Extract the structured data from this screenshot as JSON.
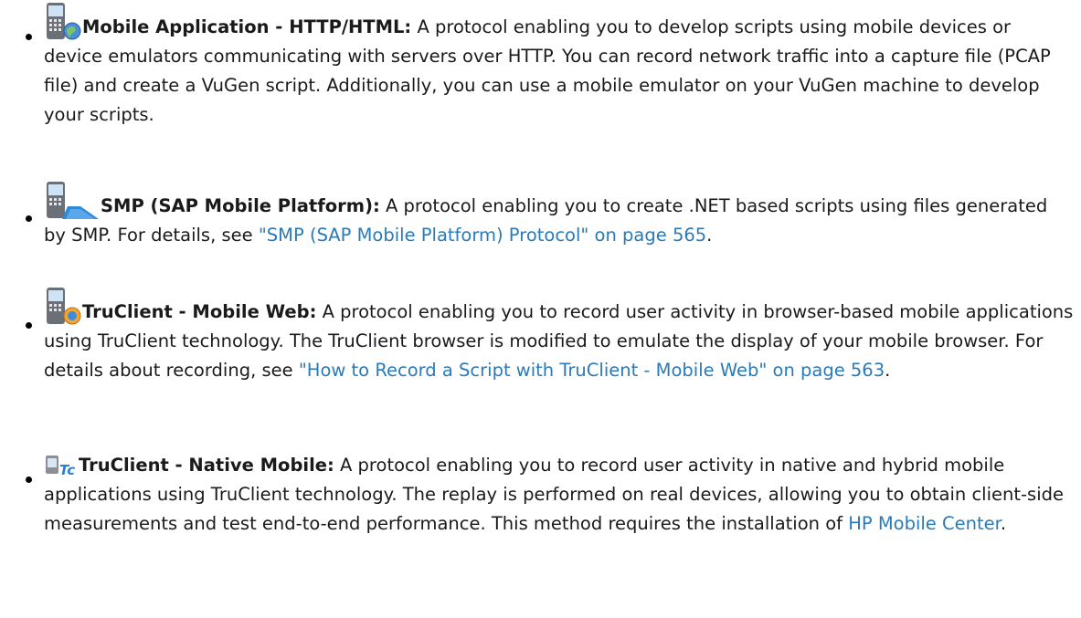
{
  "items": [
    {
      "icon": "mobile-globe-icon",
      "term": "Mobile Application - HTTP/HTML:",
      "description": "A protocol enabling you to develop scripts using mobile devices or device emulators communicating with servers over HTTP. You can record network traffic into a capture file (PCAP file) and create a VuGen script. Additionally, you can use a mobile emulator on your VuGen machine to develop your scripts."
    },
    {
      "icon": "mobile-sap-icon",
      "term": "SMP (SAP Mobile Platform):",
      "description_before_link": "A protocol enabling you to create .NET based scripts using files generated by SMP. For details, see",
      "link": "\"SMP (SAP Mobile Platform) Protocol\" on page 565",
      "description_after_link": "."
    },
    {
      "icon": "mobile-web-icon",
      "term": "TruClient - Mobile Web:",
      "description_before_link": "A protocol enabling you to record user activity in browser-based mobile applications using TruClient technology. The TruClient browser is modified to emulate the display of your mobile browser. For details about recording, see",
      "link": "\"How to Record a Script with TruClient - Mobile Web\" on page 563",
      "description_after_link": "."
    },
    {
      "icon": "truclient-native-icon",
      "term": "TruClient - Native Mobile:",
      "description_before_link": "A protocol enabling you to record user activity in native and hybrid mobile applications using TruClient technology. The replay is performed on real devices, allowing you to obtain client-side measurements and test end-to-end performance. This method requires the installation of",
      "link": "HP Mobile Center",
      "description_after_link": "."
    }
  ],
  "colors": {
    "link": "#2a7ab8",
    "text": "#1a1a1a"
  }
}
